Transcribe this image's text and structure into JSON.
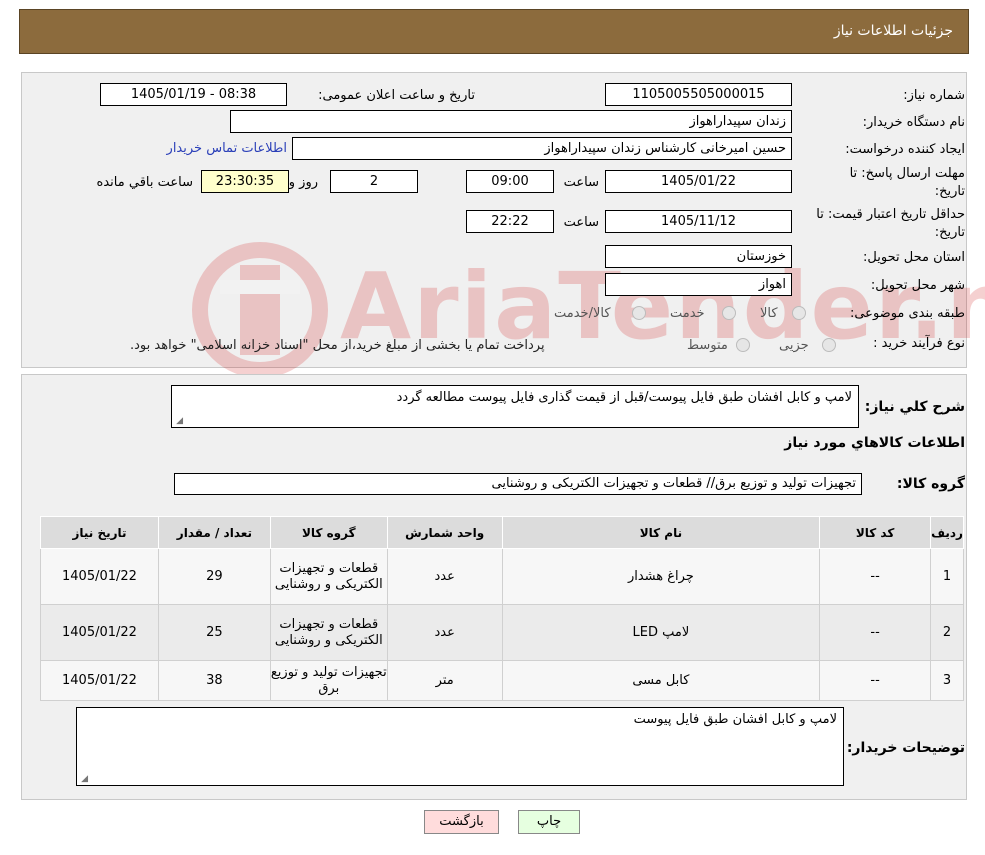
{
  "header": {
    "title": "جزئیات اطلاعات نیاز"
  },
  "form": {
    "need_number_label": "شماره نیاز:",
    "need_number": "1105005505000015",
    "announce_label": "تاریخ و ساعت اعلان عمومی:",
    "announce_value": "1405/01/19 - 08:38",
    "buyer_org_label": "نام دستگاه خریدار:",
    "buyer_org": "زندان سپیداراهواز",
    "requester_label": "ایجاد کننده درخواست:",
    "requester": "حسین امیرخانی کارشناس زندان سپیداراهواز",
    "contact_link": "اطلاعات تماس خریدار",
    "deadline_label_1": "مهلت ارسال پاسخ: تا",
    "deadline_label_2": "تاریخ:",
    "deadline_date": "1405/01/22",
    "time_label": "ساعت",
    "deadline_time": "09:00",
    "days_value": "2",
    "days_label": "روز و",
    "remaining_time": "23:30:35",
    "remaining_label": "ساعت باقي مانده",
    "validity_label_1": "حداقل تاریخ اعتبار قیمت: تا",
    "validity_label_2": "تاریخ:",
    "validity_date": "1405/11/12",
    "validity_time": "22:22",
    "province_label": "استان محل تحویل:",
    "province": "خوزستان",
    "city_label": "شهر محل تحویل:",
    "city": "اهواز",
    "category_label": "طبقه بندی موضوعی:",
    "category_options": [
      "کالا",
      "خدمت",
      "کالا/خدمت"
    ],
    "process_label": "نوع فرآیند خرید :",
    "process_options": [
      "جزیی",
      "متوسط"
    ],
    "process_note": "پرداخت تمام یا بخشی از مبلغ خرید،از محل \"اسناد خزانه اسلامی\" خواهد بود."
  },
  "watermark": "AriaTender.neT",
  "details": {
    "summary_label": "شرح کلي نياز:",
    "summary_text": "لامپ و کابل افشان طبق فایل پیوست/قبل از قیمت گذاری فایل پیوست مطالعه گردد",
    "items_heading": "اطلاعات کالاهاي مورد نياز",
    "group_label": "گروه کالا:",
    "group_value": "تجهیزات تولید و توزیع برق// قطعات و تجهیزات الکتریکی و روشنایی"
  },
  "table": {
    "headers": [
      "ردیف",
      "کد کالا",
      "نام کالا",
      "واحد شمارش",
      "گروه کالا",
      "تعداد / مقدار",
      "تاریخ نیاز"
    ],
    "rows": [
      {
        "row": "1",
        "code": "--",
        "name": "چراغ هشدار",
        "unit": "عدد",
        "group": "قطعات و تجهیزات الکتریکی و روشنایی",
        "qty": "29",
        "date": "1405/01/22"
      },
      {
        "row": "2",
        "code": "--",
        "name": "لامپ LED",
        "unit": "عدد",
        "group": "قطعات و تجهیزات الکتریکی و روشنایی",
        "qty": "25",
        "date": "1405/01/22"
      },
      {
        "row": "3",
        "code": "--",
        "name": "کابل مسی",
        "unit": "متر",
        "group": "تجهیزات تولید و توزیع برق",
        "qty": "38",
        "date": "1405/01/22"
      }
    ]
  },
  "buyer_notes": {
    "label": "توضیحات خریدار:",
    "text": "لامپ و کابل افشان طبق فایل پیوست"
  },
  "buttons": {
    "back": "بازگشت",
    "print": "چاپ"
  }
}
